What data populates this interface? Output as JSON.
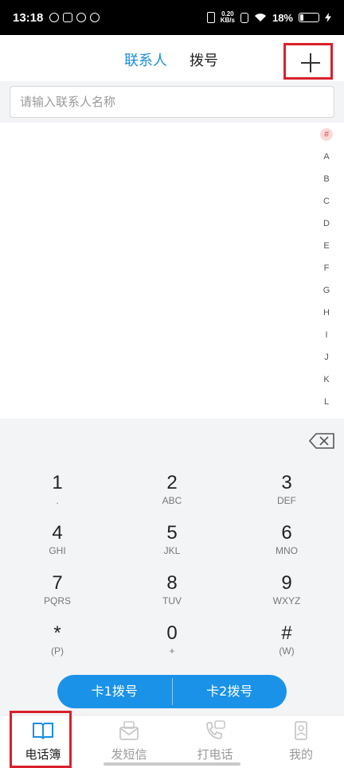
{
  "status_bar": {
    "time": "13:18",
    "net_speed_value": "0.20",
    "net_speed_unit": "KB/s",
    "battery": "18%"
  },
  "header": {
    "tabs": [
      {
        "label": "联系人"
      },
      {
        "label": "拨号"
      }
    ],
    "add_icon": "plus-icon"
  },
  "search": {
    "placeholder": "请输入联系人名称"
  },
  "index": [
    "#",
    "A",
    "B",
    "C",
    "D",
    "E",
    "F",
    "G",
    "H",
    "I",
    "J",
    "K",
    "L"
  ],
  "keypad": {
    "keys": [
      {
        "digit": "1",
        "letters": "."
      },
      {
        "digit": "2",
        "letters": "ABC"
      },
      {
        "digit": "3",
        "letters": "DEF"
      },
      {
        "digit": "4",
        "letters": "GHI"
      },
      {
        "digit": "5",
        "letters": "JKL"
      },
      {
        "digit": "6",
        "letters": "MNO"
      },
      {
        "digit": "7",
        "letters": "PQRS"
      },
      {
        "digit": "8",
        "letters": "TUV"
      },
      {
        "digit": "9",
        "letters": "WXYZ"
      },
      {
        "digit": "*",
        "letters": "(P)"
      },
      {
        "digit": "0",
        "letters": "+"
      },
      {
        "digit": "#",
        "letters": "(W)"
      }
    ],
    "dial_sim1": "卡1拨号",
    "dial_sim2": "卡2拨号"
  },
  "bottom_nav": {
    "items": [
      {
        "label": "电话簿"
      },
      {
        "label": "发短信"
      },
      {
        "label": "打电话"
      },
      {
        "label": "我的"
      }
    ]
  },
  "colors": {
    "accent": "#1a8ee1",
    "highlight": "#d9202c"
  }
}
